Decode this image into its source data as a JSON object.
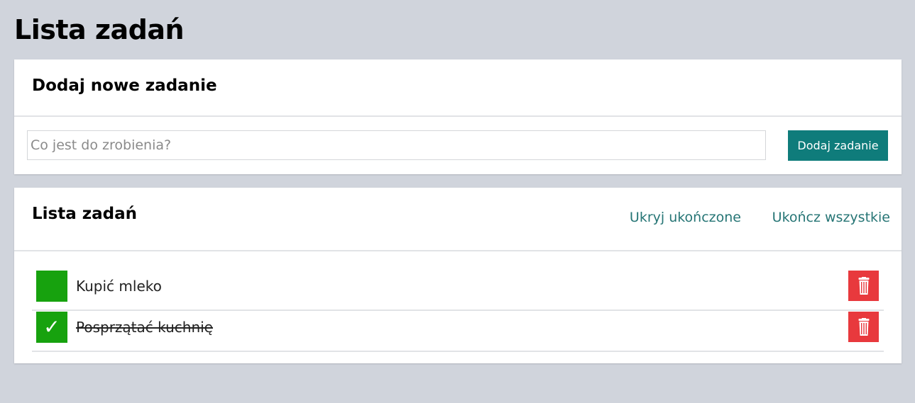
{
  "page": {
    "title": "Lista zadań"
  },
  "add_section": {
    "title": "Dodaj nowe zadanie",
    "input_placeholder": "Co jest do zrobienia?",
    "input_value": "",
    "button_label": "Dodaj zadanie"
  },
  "list_section": {
    "title": "Lista zadań",
    "hide_completed_label": "Ukryj ukończone",
    "complete_all_label": "Ukończ wszystkie",
    "tasks": [
      {
        "label": "Kupić mleko",
        "completed": false,
        "check_glyph": ""
      },
      {
        "label": "Posprzątać kuchnię",
        "completed": true,
        "check_glyph": "✓"
      }
    ]
  },
  "icons": {
    "checkbox": "check-icon",
    "delete": "trash-icon"
  },
  "colors": {
    "background": "#d0d4dc",
    "accent": "#0f7c7b",
    "link": "#267575",
    "checkbox": "#17a20e",
    "delete": "#e8393d"
  }
}
